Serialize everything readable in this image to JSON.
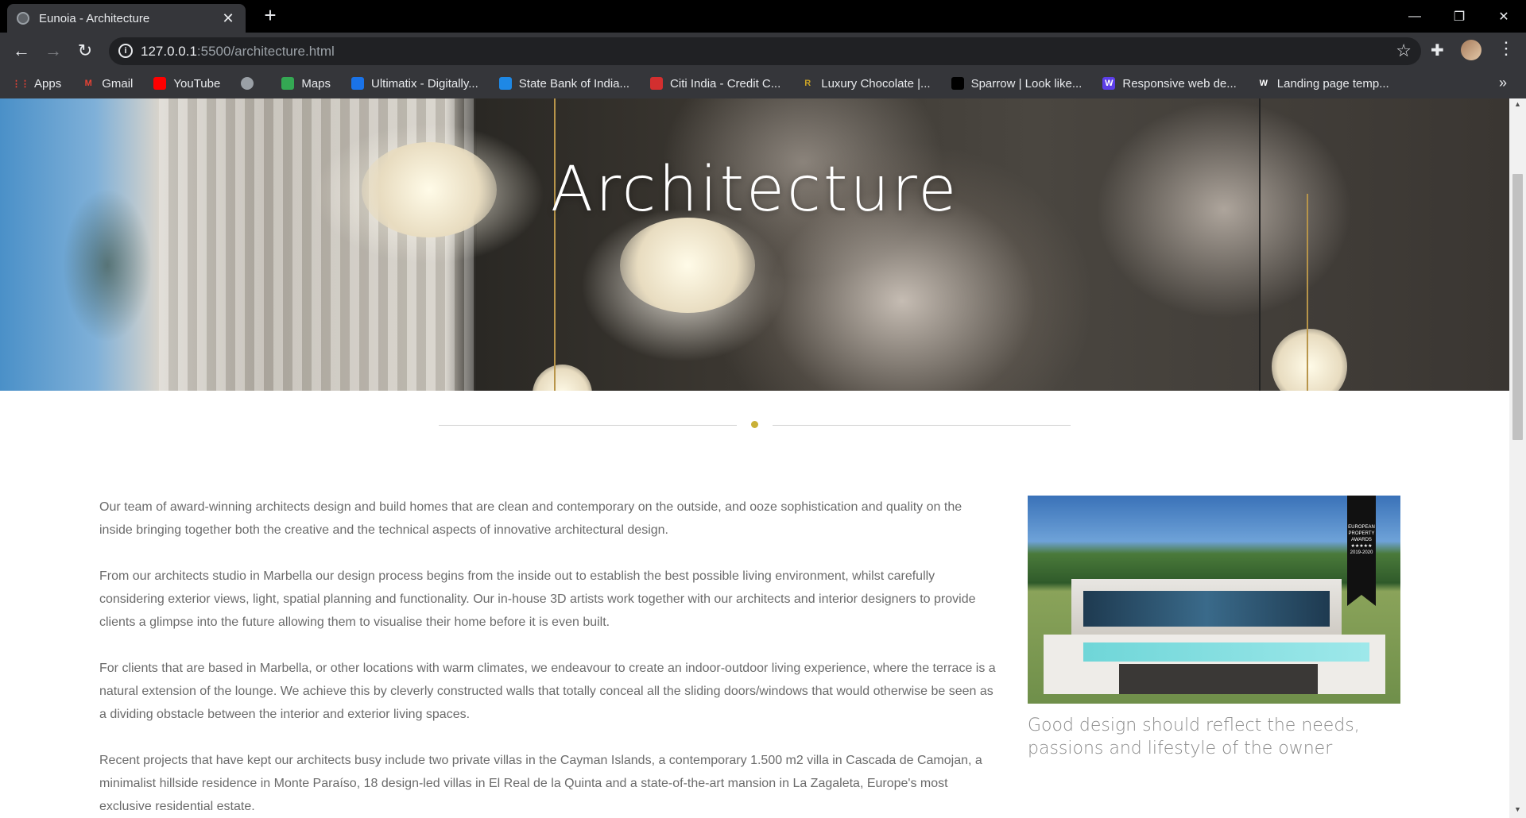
{
  "browser": {
    "tab_title": "Eunoia - Architecture",
    "tab_close": "✕",
    "new_tab": "+",
    "url_host": "127.0.0.1",
    "url_path": ":5500/architecture.html",
    "win_minimize": "—",
    "win_restore": "❐",
    "win_close": "✕"
  },
  "bookmarks": [
    {
      "label": "Apps",
      "icon": "apps-grid-icon",
      "color": "#ea4335"
    },
    {
      "label": "Gmail",
      "icon": "gmail-icon",
      "color": "#ea4335"
    },
    {
      "label": "YouTube",
      "icon": "youtube-icon",
      "color": "#ff0000"
    },
    {
      "label": "",
      "icon": "globe-icon",
      "color": "#9aa0a6"
    },
    {
      "label": "Maps",
      "icon": "maps-icon",
      "color": "#34a853"
    },
    {
      "label": "Ultimatix - Digitally...",
      "icon": "ultimatix-icon",
      "color": "#1a73e8"
    },
    {
      "label": "State Bank of India...",
      "icon": "sbi-icon",
      "color": "#1e88e5"
    },
    {
      "label": "Citi India - Credit C...",
      "icon": "citi-icon",
      "color": "#d32f2f"
    },
    {
      "label": "Luxury Chocolate |...",
      "icon": "r-letter-icon",
      "color": "#c9a227"
    },
    {
      "label": "Sparrow | Look like...",
      "icon": "sparrow-icon",
      "color": "#000000"
    },
    {
      "label": "Responsive web de...",
      "icon": "w-letter-icon",
      "color": "#5c3ee8"
    },
    {
      "label": "Landing page temp...",
      "icon": "w-letter-icon",
      "color": "#ffffff"
    }
  ],
  "bookmarks_overflow": "»",
  "hero": {
    "title": "Architecture"
  },
  "content": {
    "paragraphs": [
      "Our team of award-winning architects design and build homes that are clean and contemporary on the outside, and ooze sophistication and quality on the inside bringing together both the creative and the technical aspects of innovative architectural design.",
      "From our architects studio in Marbella our design process begins from the inside out to establish the best possible living environment, whilst carefully considering exterior views, light, spatial planning and functionality. Our in-house 3D artists work together with our architects and interior designers to provide clients a glimpse into the future allowing them to visualise their home before it is even built.",
      "For clients that are based in Marbella, or other locations with warm climates, we endeavour to create an indoor-outdoor living experience, where the terrace is a natural extension of the lounge. We achieve this by cleverly constructed walls that totally conceal all the sliding doors/windows that would otherwise be seen as a dividing obstacle between the interior and exterior living spaces.",
      "Recent projects that have kept our architects busy include two private villas in the Cayman Islands, a contemporary 1.500 m2 villa in Cascada de Camojan, a minimalist hillside residence in Monte Paraíso, 18 design-led villas in El Real de la Quinta and a state-of-the-art mansion in La Zagaleta, Europe's most exclusive residential estate."
    ],
    "caption": "Good design should reflect the needs, passions and lifestyle of the owner",
    "award_text": "EUROPEAN PROPERTY AWARDS ★★★★★ 2019-2020"
  },
  "colors": {
    "accent_dot": "#c9b037",
    "body_text": "#6b6b6b",
    "caption_text": "#8a8a8a"
  }
}
